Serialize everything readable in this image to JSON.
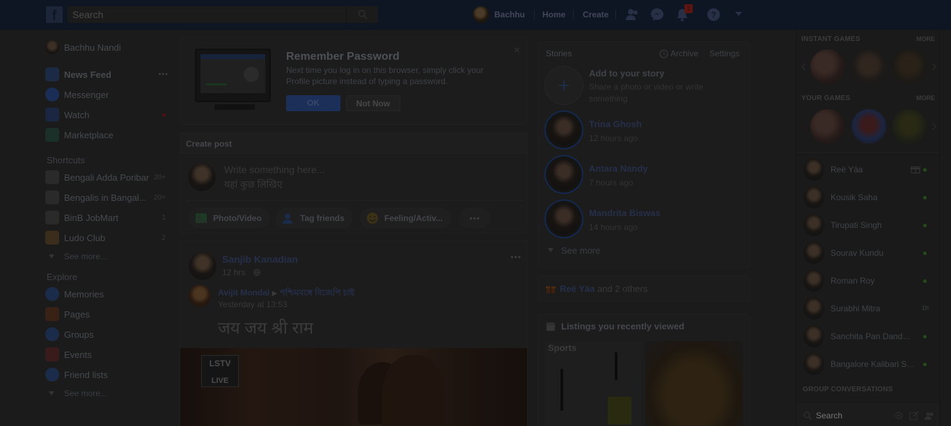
{
  "topbar": {
    "logo": "f",
    "search_placeholder": "Search",
    "profile_name": "Bachhu",
    "home": "Home",
    "create": "Create",
    "notifications_count": "1"
  },
  "left_sidebar": {
    "profile": "Bachhu Nandi",
    "main": [
      {
        "label": "News Feed",
        "icon": "news-feed-icon"
      },
      {
        "label": "Messenger",
        "icon": "messenger-icon"
      },
      {
        "label": "Watch",
        "icon": "watch-icon"
      },
      {
        "label": "Marketplace",
        "icon": "marketplace-icon"
      }
    ],
    "more_dots": "•••",
    "shortcuts_title": "Shortcuts",
    "shortcuts": [
      {
        "label": "Bengali Adda Poribar",
        "count": "20+"
      },
      {
        "label": "Bengalis in Bangal...",
        "count": "20+"
      },
      {
        "label": "BinB JobMart",
        "count": "1"
      },
      {
        "label": "Ludo Club",
        "count": "2"
      }
    ],
    "see_more_1": "See more...",
    "explore_title": "Explore",
    "explore": [
      {
        "label": "Memories",
        "icon": "memories-icon"
      },
      {
        "label": "Pages",
        "icon": "pages-flag-icon"
      },
      {
        "label": "Groups",
        "icon": "groups-icon"
      },
      {
        "label": "Events",
        "icon": "events-icon"
      },
      {
        "label": "Friend lists",
        "icon": "friend-lists-icon"
      }
    ],
    "see_more_2": "See more..."
  },
  "remember": {
    "title": "Remember Password",
    "body": "Next time you log in on this browser, simply click your Profile picture instead of typing a password.",
    "ok": "OK",
    "not_now": "Not Now",
    "close": "×"
  },
  "create_post": {
    "title": "Create post",
    "placeholder_en": "Write something here...",
    "placeholder_hi": "यहां कुछ लिखिए",
    "actions": [
      "Photo/Video",
      "Tag friends",
      "Feeling/Activ..."
    ],
    "more": "•••"
  },
  "post": {
    "author": "Sanjib Kanadian",
    "time": "12 hrs",
    "more": "•••",
    "shared_author": "Avijit Mondal",
    "arrow": "▶",
    "group": "পশ্চিমবঙ্গে বিজেপি চাই",
    "shared_time": "Yesterday at 13:53",
    "text": "जय जय श्री राम",
    "tv_logo": "LSTV",
    "tv_live": "LIVE"
  },
  "stories": {
    "title": "Stories",
    "archive": "Archive",
    "settings": "Settings",
    "add_title": "Add to your story",
    "add_sub": "Share a photo or video or write something",
    "items": [
      {
        "name": "Trina Ghosh",
        "time": "12 hours ago"
      },
      {
        "name": "Antara Nandy",
        "time": "7 hours ago"
      },
      {
        "name": "Mandrita Biswas",
        "time": "14 hours ago"
      }
    ],
    "see_more": "See more"
  },
  "birthdays": {
    "name": "Reë Yäa",
    "rest": " and 2 others"
  },
  "listings": {
    "title": "Listings you recently viewed",
    "item1_label": "Sports"
  },
  "right_sidebar": {
    "instant_games": "INSTANT GAMES",
    "your_games": "YOUR GAMES",
    "more": "MORE",
    "contacts": [
      {
        "name": "Reë Yäa",
        "status": "gift"
      },
      {
        "name": "Kousik Saha",
        "status": "online"
      },
      {
        "name": "Tirupati Singh",
        "status": "online"
      },
      {
        "name": "Sourav Kundu",
        "status": "online"
      },
      {
        "name": "Roman Roy",
        "status": "online"
      },
      {
        "name": "Surabhi Mitra",
        "status": "1h"
      },
      {
        "name": "Sanchita Pan Dandapat",
        "status": "online"
      },
      {
        "name": "Bangalore Kalibari Sh...",
        "status": "online"
      }
    ],
    "group_conversations": "GROUP CONVERSATIONS",
    "search_placeholder": "Search"
  }
}
